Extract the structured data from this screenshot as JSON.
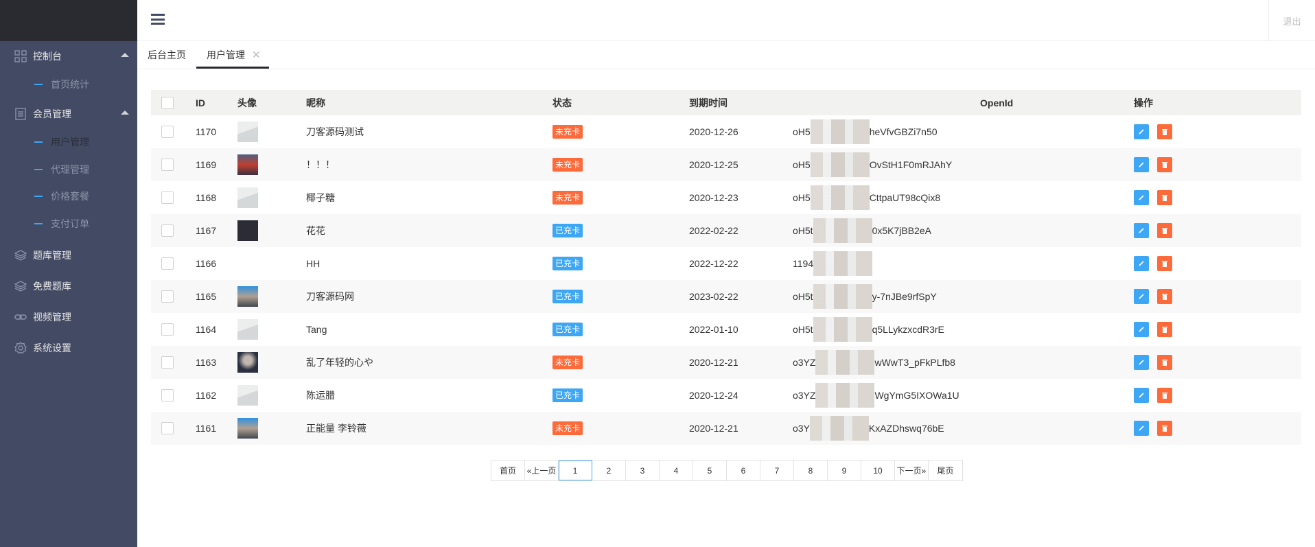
{
  "header": {
    "logout": "退出"
  },
  "sidebar": {
    "groups": [
      {
        "label": "控制台",
        "icon": "dashboard-icon"
      },
      {
        "label": "会员管理",
        "icon": "list-icon"
      },
      {
        "label": "题库管理",
        "icon": "layers-icon"
      },
      {
        "label": "免费题库",
        "icon": "layers-icon"
      },
      {
        "label": "视频管理",
        "icon": "link-icon"
      },
      {
        "label": "系统设置",
        "icon": "gear-icon"
      }
    ],
    "sub_dashboard": [
      "首页统计"
    ],
    "sub_member": [
      "用户管理",
      "代理管理",
      "价格套餐",
      "支付订单"
    ]
  },
  "tabs": [
    {
      "label": "后台主页"
    },
    {
      "label": "用户管理",
      "close": "✕"
    }
  ],
  "table": {
    "headers": {
      "id": "ID",
      "avatar": "头像",
      "nickname": "昵称",
      "status": "状态",
      "expire": "到期时间",
      "openid": "OpenId",
      "ops": "操作"
    },
    "rows": [
      {
        "id": "1170",
        "avatar": "mtn",
        "nickname": "刀客源码测试",
        "status": "未充卡",
        "expire": "2020-12-26",
        "openid_prefix": "oH5",
        "openid_suffix": "heVfvGBZi7n50"
      },
      {
        "id": "1169",
        "avatar": "color1",
        "nickname": "！！！",
        "status": "未充卡",
        "expire": "2020-12-25",
        "openid_prefix": "oH5",
        "openid_suffix": "OvStH1F0mRJAhY"
      },
      {
        "id": "1168",
        "avatar": "mtn",
        "nickname": "椰子糖",
        "status": "未充卡",
        "expire": "2020-12-23",
        "openid_prefix": "oH5",
        "openid_suffix": "CttpaUT98cQix8"
      },
      {
        "id": "1167",
        "avatar": "dark",
        "nickname": "花花",
        "status": "已充卡",
        "expire": "2022-02-22",
        "openid_prefix": "oH5t",
        "openid_suffix": "0x5K7jBB2eA"
      },
      {
        "id": "1166",
        "avatar": "none",
        "nickname": "HH",
        "status": "已充卡",
        "expire": "2022-12-22",
        "openid_prefix": "1194",
        "openid_suffix": ""
      },
      {
        "id": "1165",
        "avatar": "color2",
        "nickname": "刀客源码网",
        "status": "已充卡",
        "expire": "2023-02-22",
        "openid_prefix": "oH5t",
        "openid_suffix": "y-7nJBe9rfSpY"
      },
      {
        "id": "1164",
        "avatar": "mtn",
        "nickname": "Tang",
        "status": "已充卡",
        "expire": "2022-01-10",
        "openid_prefix": "oH5t",
        "openid_suffix": "q5LLykzxcdR3rE"
      },
      {
        "id": "1163",
        "avatar": "color3",
        "nickname": "乱了年轻的心や",
        "status": "未充卡",
        "expire": "2020-12-21",
        "openid_prefix": "o3YZ",
        "openid_suffix": "wWwT3_pFkPLfb8"
      },
      {
        "id": "1162",
        "avatar": "mtn",
        "nickname": "陈运腊",
        "status": "已充卡",
        "expire": "2020-12-24",
        "openid_prefix": "o3YZ",
        "openid_suffix": "WgYmG5IXOWa1U"
      },
      {
        "id": "1161",
        "avatar": "color2",
        "nickname": "正能量 李铃薇",
        "status": "未充卡",
        "expire": "2020-12-21",
        "openid_prefix": "o3Y",
        "openid_suffix": "KxAZDhswq76bE"
      }
    ]
  },
  "status_colors": {
    "未充卡": "#ff6a3a",
    "已充卡": "#3ea7f5"
  },
  "pagination": {
    "first": "首页",
    "prev": "«上一页",
    "pages": [
      "1",
      "2",
      "3",
      "4",
      "5",
      "6",
      "7",
      "8",
      "9",
      "10"
    ],
    "current": "1",
    "next": "下一页»",
    "last": "尾页"
  }
}
